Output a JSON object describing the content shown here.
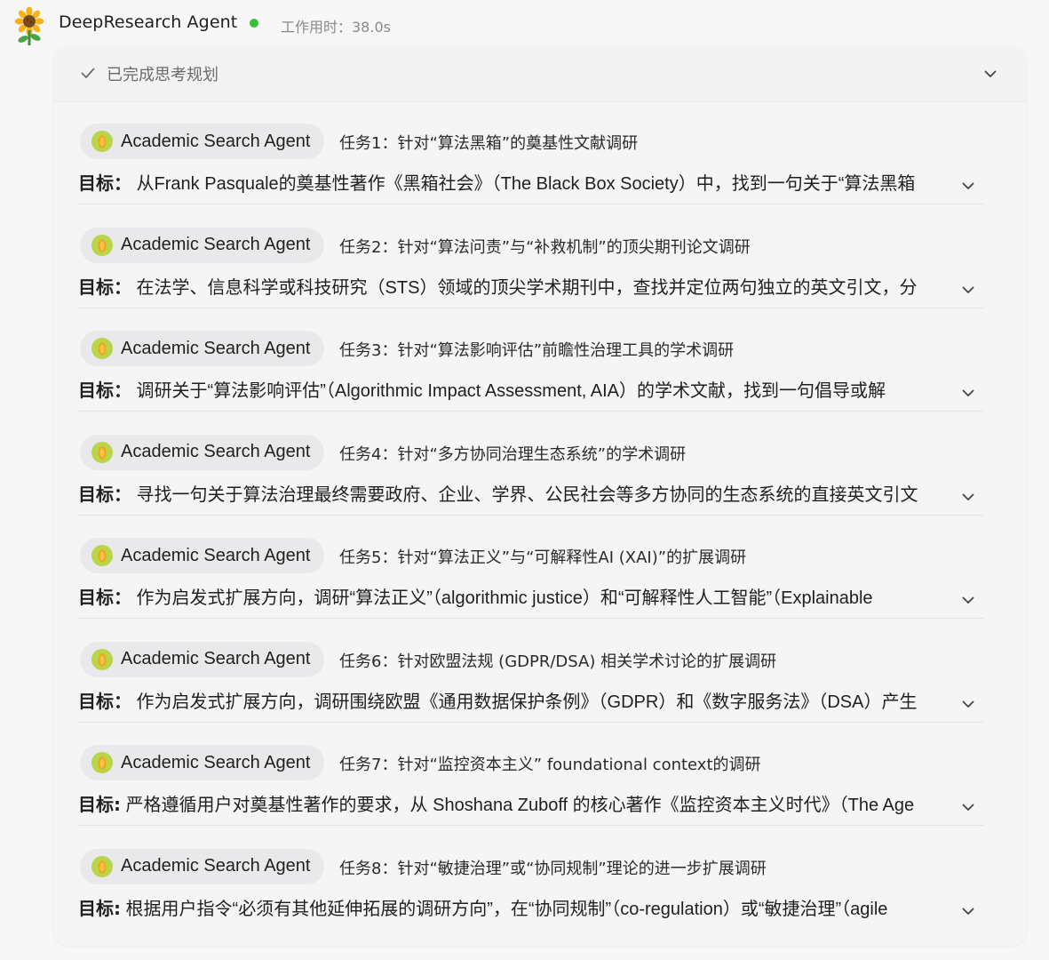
{
  "header": {
    "app_name": "DeepResearch Agent",
    "status_color": "#36c13b",
    "work_time": "工作用时：38.0s",
    "avatar_icon": "sunflower-icon"
  },
  "plan": {
    "status": "已完成思考规划",
    "status_icon": "check-icon",
    "toggle_icon": "chevron-down-icon"
  },
  "tasks": [
    {
      "agent": "Academic Search Agent",
      "title": "任务1：针对“算法黑箱”的奠基性文献调研",
      "goal_label": "目标：",
      "goal_text": " 从Frank Pasquale的奠基性著作《黑箱社会》（The Black Box Society）中，找到一句关于“算法黑箱"
    },
    {
      "agent": "Academic Search Agent",
      "title": "任务2：针对“算法问责”与“补救机制”的顶尖期刊论文调研",
      "goal_label": "目标：",
      "goal_text": " 在法学、信息科学或科技研究（STS）领域的顶尖学术期刊中，查找并定位两句独立的英文引文，分"
    },
    {
      "agent": "Academic Search Agent",
      "title": "任务3：针对“算法影响评估”前瞻性治理工具的学术调研",
      "goal_label": "目标：",
      "goal_text": " 调研关于“算法影响评估”（Algorithmic Impact Assessment, AIA）的学术文献，找到一句倡导或解"
    },
    {
      "agent": "Academic Search Agent",
      "title": "任务4：针对“多方协同治理生态系统”的学术调研",
      "goal_label": "目标：",
      "goal_text": " 寻找一句关于算法治理最终需要政府、企业、学界、公民社会等多方协同的生态系统的直接英文引文"
    },
    {
      "agent": "Academic Search Agent",
      "title": "任务5：针对“算法正义”与“可解释性AI (XAI)”的扩展调研",
      "goal_label": "目标：",
      "goal_text": " 作为启发式扩展方向，调研“算法正义”（algorithmic justice）和“可解释性人工智能”（Explainable"
    },
    {
      "agent": "Academic Search Agent",
      "title": "任务6：针对欧盟法规 (GDPR/DSA) 相关学术讨论的扩展调研",
      "goal_label": "目标：",
      "goal_text": " 作为启发式扩展方向，调研围绕欧盟《通用数据保护条例》（GDPR）和《数字服务法》（DSA）产生"
    },
    {
      "agent": "Academic Search Agent",
      "title": "任务7：针对“监控资本主义” foundational context的调研",
      "goal_label": "目标:",
      "goal_text": " 严格遵循用户对奠基性著作的要求，从 Shoshana Zuboff 的核心著作《监控资本主义时代》（The Age"
    },
    {
      "agent": "Academic Search Agent",
      "title": "任务8：针对“敏捷治理”或“协同规制”理论的进一步扩展调研",
      "goal_label": "目标:",
      "goal_text": " 根据用户指令“必须有其他延伸拓展的调研方向”，在“协同规制”（co-regulation）或“敏捷治理”（agile"
    }
  ]
}
